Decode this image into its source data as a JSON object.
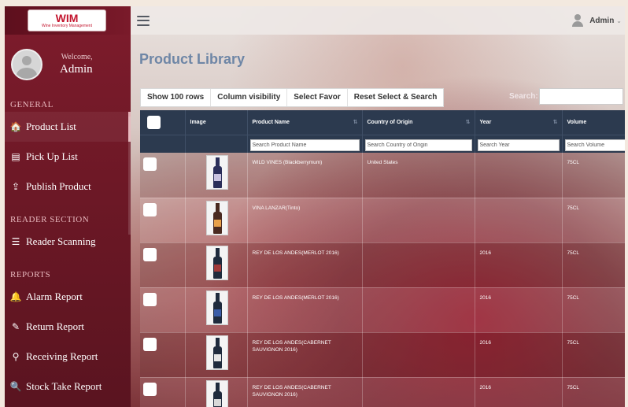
{
  "app": {
    "logo_mark": "WIM",
    "logo_subtitle": "Wine Inventory Management"
  },
  "sidebar": {
    "welcome_label": "Welcome,",
    "welcome_user": "Admin",
    "sections": [
      {
        "title": "GENERAL",
        "items": [
          {
            "label": "Product List",
            "icon": "home-icon",
            "active": true
          },
          {
            "label": "Pick Up List",
            "icon": "list-icon"
          },
          {
            "label": "Publish Product",
            "icon": "upload-icon"
          }
        ]
      },
      {
        "title": "READER SECTION",
        "items": [
          {
            "label": "Reader Scanning",
            "icon": "rss-icon"
          }
        ]
      },
      {
        "title": "REPORTS",
        "items": [
          {
            "label": "Alarm Report",
            "icon": "bell-icon"
          },
          {
            "label": "Return Report",
            "icon": "edit-icon"
          },
          {
            "label": "Receiving Report",
            "icon": "pin-icon"
          },
          {
            "label": "Stock Take Report",
            "icon": "search-icon"
          }
        ]
      }
    ]
  },
  "topbar": {
    "user_name": "Admin",
    "caret": "⌄"
  },
  "main": {
    "title": "Product Library",
    "toolbar": {
      "show_rows": "Show 100 rows",
      "column_visibility": "Column visibility",
      "select_favor": "Select Favor",
      "reset_select_search": "Reset Select & Search"
    },
    "search": {
      "label": "Search:",
      "value": ""
    },
    "table": {
      "columns": [
        "",
        "Image",
        "Product Name",
        "Country of Origin",
        "Year",
        "Volume"
      ],
      "filters": {
        "product_name": "Search Product Name",
        "country": "Search Country of Origin",
        "year": "Search Year",
        "volume": "Search Volume"
      },
      "rows": [
        {
          "name": "WILD VINES (Blackberrymum)",
          "country": "United States",
          "year": "",
          "volume": "75CL",
          "bottle": {
            "body": "#2b2f5a",
            "label": "#c9c3e0"
          }
        },
        {
          "name": "VINA LANZAR(Tinto)",
          "country": "",
          "year": "",
          "volume": "75CL",
          "bottle": {
            "body": "#4a2a20",
            "label": "#e8a14a"
          }
        },
        {
          "name": "REY DE LOS ANDES(MERLOT 2016)",
          "country": "",
          "year": "2016",
          "volume": "75CL",
          "bottle": {
            "body": "#1f2b3d",
            "label": "#a23a3a"
          }
        },
        {
          "name": "REY DE LOS ANDES(MERLOT 2016)",
          "country": "",
          "year": "2016",
          "volume": "75CL",
          "bottle": {
            "body": "#1f2b3d",
            "label": "#3a5da8"
          }
        },
        {
          "name": "REY DE LOS ANDES(CABERNET SAUVIGNON 2016)",
          "country": "",
          "year": "2016",
          "volume": "75CL",
          "bottle": {
            "body": "#1f2b3d",
            "label": "#e6e6e6"
          }
        },
        {
          "name": "REY DE LOS ANDES(CABERNET SAUVIGNON 2016)",
          "country": "",
          "year": "2016",
          "volume": "75CL",
          "bottle": {
            "body": "#1f2b3d",
            "label": "#d8d8d8"
          }
        }
      ]
    }
  },
  "icons": {
    "home-icon": "🏠",
    "list-icon": "▤",
    "upload-icon": "⇪",
    "rss-icon": "☰",
    "bell-icon": "🔔",
    "edit-icon": "✎",
    "pin-icon": "⚲",
    "search-icon": "🔍",
    "sort-icon": "⇅"
  }
}
